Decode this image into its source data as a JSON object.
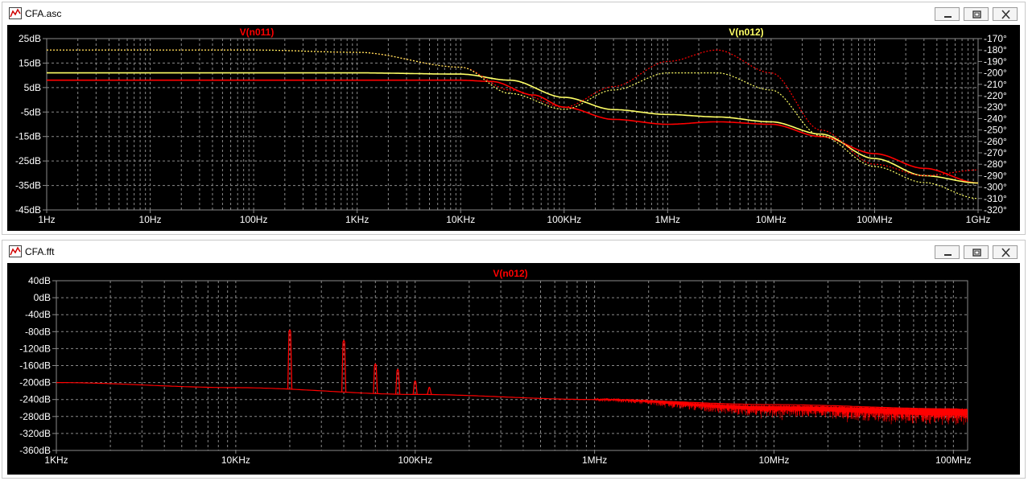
{
  "windows": [
    {
      "title": "CFA.asc"
    },
    {
      "title": "CFA.fft"
    }
  ],
  "colors": {
    "background": "#000000",
    "grid": "#8a8a8a",
    "axis_text": "#ffffff",
    "red": "#ff0000",
    "yellow": "#ffff66"
  },
  "chart_data": [
    {
      "type": "line",
      "title": "",
      "x_scale": "log",
      "xlim": [
        1,
        1000000000
      ],
      "x_ticks": [
        {
          "value": 1,
          "label": "1Hz"
        },
        {
          "value": 10,
          "label": "10Hz"
        },
        {
          "value": 100,
          "label": "100Hz"
        },
        {
          "value": 1000,
          "label": "1KHz"
        },
        {
          "value": 10000,
          "label": "10KHz"
        },
        {
          "value": 100000,
          "label": "100KHz"
        },
        {
          "value": 1000000,
          "label": "1MHz"
        },
        {
          "value": 10000000,
          "label": "10MHz"
        },
        {
          "value": 100000000,
          "label": "100MHz"
        },
        {
          "value": 1000000000,
          "label": "1GHz"
        }
      ],
      "ylim": [
        -45,
        25
      ],
      "y_ticks": [
        {
          "value": 25,
          "label": "25dB"
        },
        {
          "value": 15,
          "label": "15dB"
        },
        {
          "value": 5,
          "label": "5dB"
        },
        {
          "value": -5,
          "label": "-5dB"
        },
        {
          "value": -15,
          "label": "-15dB"
        },
        {
          "value": -25,
          "label": "-25dB"
        },
        {
          "value": -35,
          "label": "-35dB"
        },
        {
          "value": -45,
          "label": "-45dB"
        }
      ],
      "y2lim": [
        -320,
        -170
      ],
      "y2_ticks": [
        "-170°",
        "-180°",
        "-190°",
        "-200°",
        "-210°",
        "-220°",
        "-230°",
        "-240°",
        "-250°",
        "-260°",
        "-270°",
        "-280°",
        "-290°",
        "-300°",
        "-310°",
        "-320°"
      ],
      "legend": [
        {
          "name": "V(n011)",
          "color": "#ff0000",
          "position": "top-left"
        },
        {
          "name": "V(n012)",
          "color": "#ffff66",
          "position": "top-right"
        }
      ],
      "series": [
        {
          "name": "V(n011)",
          "kind": "magnitude",
          "color": "#ff0000",
          "dashed": false,
          "x": [
            1,
            1000,
            10000,
            20000,
            50000,
            100000,
            300000,
            1000000,
            3000000,
            10000000,
            30000000,
            100000000,
            300000000,
            1000000000
          ],
          "y": [
            8,
            8,
            8,
            7.5,
            2,
            -3,
            -8,
            -10,
            -9,
            -10,
            -15,
            -22,
            -28,
            -34
          ]
        },
        {
          "name": "V(n012)",
          "kind": "magnitude",
          "color": "#ffff66",
          "dashed": false,
          "x": [
            1,
            1000,
            10000,
            30000,
            100000,
            300000,
            1000000,
            3000000,
            10000000,
            30000000,
            100000000,
            300000000,
            1000000000
          ],
          "y": [
            11,
            11,
            10.5,
            8,
            1,
            -4,
            -6,
            -7,
            -9,
            -14,
            -24,
            -31,
            -34
          ]
        },
        {
          "name": "V(n011)",
          "kind": "phase",
          "color": "#ff0000",
          "dashed": true,
          "x": [
            1,
            100,
            1000,
            10000,
            30000,
            100000,
            300000,
            1000000,
            3000000,
            10000000,
            30000000,
            100000000,
            300000000,
            1000000000
          ],
          "y": [
            -180,
            -180,
            -182,
            -195,
            -215,
            -230,
            -212,
            -190,
            -180,
            -200,
            -250,
            -280,
            -290,
            -285
          ]
        },
        {
          "name": "V(n012)",
          "kind": "phase",
          "color": "#ffff66",
          "dashed": true,
          "x": [
            1,
            100,
            1000,
            10000,
            30000,
            100000,
            300000,
            1000000,
            3000000,
            10000000,
            30000000,
            100000000,
            300000000,
            1000000000
          ],
          "y": [
            -180,
            -180,
            -182,
            -195,
            -218,
            -232,
            -215,
            -200,
            -200,
            -215,
            -255,
            -282,
            -296,
            -310
          ]
        }
      ]
    },
    {
      "type": "line",
      "title": "",
      "x_scale": "log",
      "xlim": [
        1000,
        120000000
      ],
      "x_ticks": [
        {
          "value": 1000,
          "label": "1KHz"
        },
        {
          "value": 10000,
          "label": "10KHz"
        },
        {
          "value": 100000,
          "label": "100KHz"
        },
        {
          "value": 1000000,
          "label": "1MHz"
        },
        {
          "value": 10000000,
          "label": "10MHz"
        },
        {
          "value": 100000000,
          "label": "100MHz"
        }
      ],
      "ylim": [
        -360,
        40
      ],
      "y_ticks": [
        {
          "value": 40,
          "label": "40dB"
        },
        {
          "value": 0,
          "label": "0dB"
        },
        {
          "value": -40,
          "label": "-40dB"
        },
        {
          "value": -80,
          "label": "-80dB"
        },
        {
          "value": -120,
          "label": "-120dB"
        },
        {
          "value": -160,
          "label": "-160dB"
        },
        {
          "value": -200,
          "label": "-200dB"
        },
        {
          "value": -240,
          "label": "-240dB"
        },
        {
          "value": -280,
          "label": "-280dB"
        },
        {
          "value": -320,
          "label": "-320dB"
        },
        {
          "value": -360,
          "label": "-360dB"
        }
      ],
      "legend": [
        {
          "name": "V(n012)",
          "color": "#ff0000",
          "position": "top-center"
        }
      ],
      "series": [
        {
          "name": "V(n012)",
          "color": "#ff0000",
          "noise_floor": {
            "x": [
              1000,
              10000,
              100000,
              1000000,
              10000000,
              100000000,
              120000000
            ],
            "y": [
              -200,
              -212,
              -228,
              -240,
              -252,
              -262,
              -265
            ]
          },
          "noise_band": {
            "x": [
              1000000,
              10000000,
              100000000,
              120000000
            ],
            "y_low": [
              -245,
              -280,
              -300,
              -300
            ],
            "y_high": [
              -238,
              -255,
              -262,
              -262
            ]
          },
          "peaks": [
            {
              "x": 20000,
              "y": -75
            },
            {
              "x": 40000,
              "y": -100
            },
            {
              "x": 60000,
              "y": -155
            },
            {
              "x": 80000,
              "y": -168
            },
            {
              "x": 100000,
              "y": -195
            },
            {
              "x": 120000,
              "y": -210
            }
          ]
        }
      ]
    }
  ]
}
